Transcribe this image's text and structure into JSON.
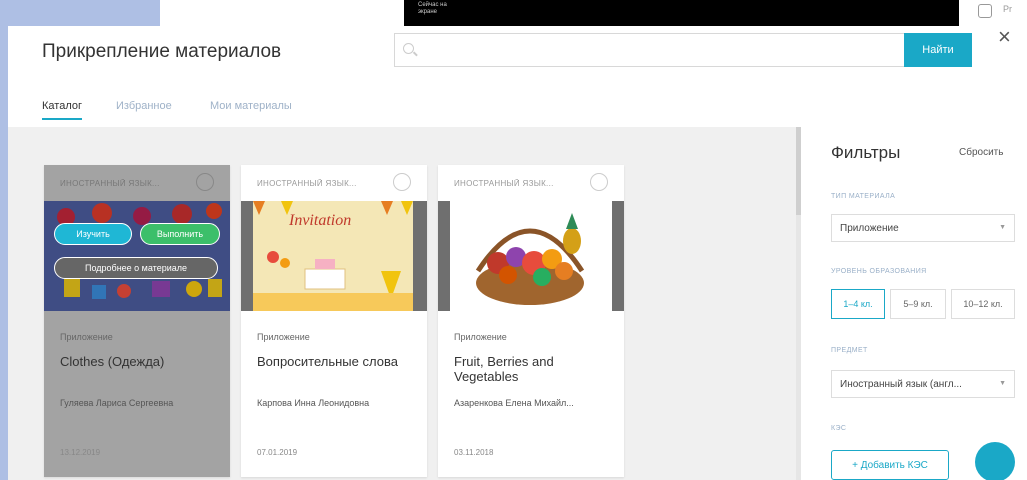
{
  "top_bar": {
    "video_caption": "Сейчас на экране",
    "right_label": "Pr"
  },
  "modal": {
    "title": "Прикрепление материалов",
    "search_placeholder": "",
    "find_label": "Найти",
    "close_label": "×"
  },
  "tabs": [
    {
      "label": "Каталог",
      "active": true
    },
    {
      "label": "Избранное",
      "active": false
    },
    {
      "label": "Мои материалы",
      "active": false
    }
  ],
  "cards": [
    {
      "category": "ИНОСТРАННЫЙ ЯЗЫК...",
      "type": "Приложение",
      "title": "Clothes (Одежда)",
      "author": "Гуляева Лариса Сергеевна",
      "date": "13.12.2019",
      "hovered": true,
      "btn_study": "Изучить",
      "btn_do": "Выполнить",
      "btn_about": "Подробнее о материале"
    },
    {
      "category": "ИНОСТРАННЫЙ ЯЗЫК...",
      "type": "Приложение",
      "title": "Вопросительные слова",
      "author": "Карпова Инна Леонидовна",
      "date": "07.01.2019",
      "hovered": false,
      "image_text": "Invitation"
    },
    {
      "category": "ИНОСТРАННЫЙ ЯЗЫК...",
      "type": "Приложение",
      "title": "Fruit, Berries and Vegetables",
      "author": "Азаренкова Елена Михайл...",
      "date": "03.11.2018",
      "hovered": false
    }
  ],
  "filters": {
    "title": "Фильтры",
    "reset": "Сбросить",
    "material_type_label": "ТИП МАТЕРИАЛА",
    "material_type_value": "Приложение",
    "level_label": "УРОВЕНЬ ОБРАЗОВАНИЯ",
    "levels": [
      {
        "label": "1–4 кл.",
        "active": true
      },
      {
        "label": "5–9 кл.",
        "active": false
      },
      {
        "label": "10–12 кл.",
        "active": false
      }
    ],
    "subject_label": "ПРЕДМЕТ",
    "subject_value": "Иностранный язык (англ...",
    "kes_label": "КЭС",
    "add_kes": "+ Добавить КЭС"
  },
  "colors": {
    "accent": "#1aa8c7",
    "success": "#3cbf6a"
  }
}
